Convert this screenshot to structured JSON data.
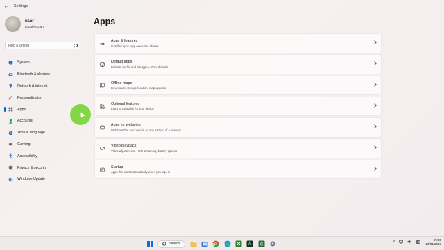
{
  "window": {
    "title": "Settings",
    "back_glyph": "←"
  },
  "profile": {
    "name": "user",
    "account_type": "Local Account"
  },
  "search": {
    "placeholder": "Find a setting"
  },
  "nav": [
    {
      "label": "System",
      "icon": "monitor-icon",
      "color": "#0a74d8"
    },
    {
      "label": "Bluetooth & devices",
      "icon": "bluetooth-icon",
      "color": "#1b72c4"
    },
    {
      "label": "Network & internet",
      "icon": "wifi-icon",
      "color": "#2a6fb8"
    },
    {
      "label": "Personalization",
      "icon": "brush-icon",
      "color": "#c9782c"
    },
    {
      "label": "Apps",
      "icon": "apps-icon",
      "color": "#4a5a7a",
      "active": true
    },
    {
      "label": "Accounts",
      "icon": "person-icon",
      "color": "#1f9a5a"
    },
    {
      "label": "Time & language",
      "icon": "globe-clock-icon",
      "color": "#1f6fc4"
    },
    {
      "label": "Gaming",
      "icon": "gamepad-icon",
      "color": "#6b6b6b"
    },
    {
      "label": "Accessibility",
      "icon": "accessibility-icon",
      "color": "#2a7bd0"
    },
    {
      "label": "Privacy & security",
      "icon": "shield-icon",
      "color": "#6b6b6b"
    },
    {
      "label": "Windows Update",
      "icon": "update-icon",
      "color": "#1e78d2"
    }
  ],
  "main": {
    "title": "Apps",
    "cards": [
      {
        "title": "Apps & features",
        "subtitle": "Installed apps, app execution aliases",
        "icon": "list-icon"
      },
      {
        "title": "Default apps",
        "subtitle": "Defaults for file and link types, other defaults",
        "icon": "default-apps-icon"
      },
      {
        "title": "Offline maps",
        "subtitle": "Downloads, storage location, map updates",
        "icon": "map-icon"
      },
      {
        "title": "Optional features",
        "subtitle": "Extra functionality for your device",
        "icon": "grid-plus-icon"
      },
      {
        "title": "Apps for websites",
        "subtitle": "Websites that can open in an app instead of a browser",
        "icon": "web-app-icon"
      },
      {
        "title": "Video playback",
        "subtitle": "Video adjustments, HDR streaming, battery options",
        "icon": "video-icon"
      },
      {
        "title": "Startup",
        "subtitle": "Apps that start automatically when you sign in",
        "icon": "startup-icon"
      }
    ]
  },
  "taskbar": {
    "search_label": "Search",
    "time": "09:35",
    "date": "23/01/2023",
    "tray_glyph": "^",
    "accent": "#0a6fd6"
  }
}
